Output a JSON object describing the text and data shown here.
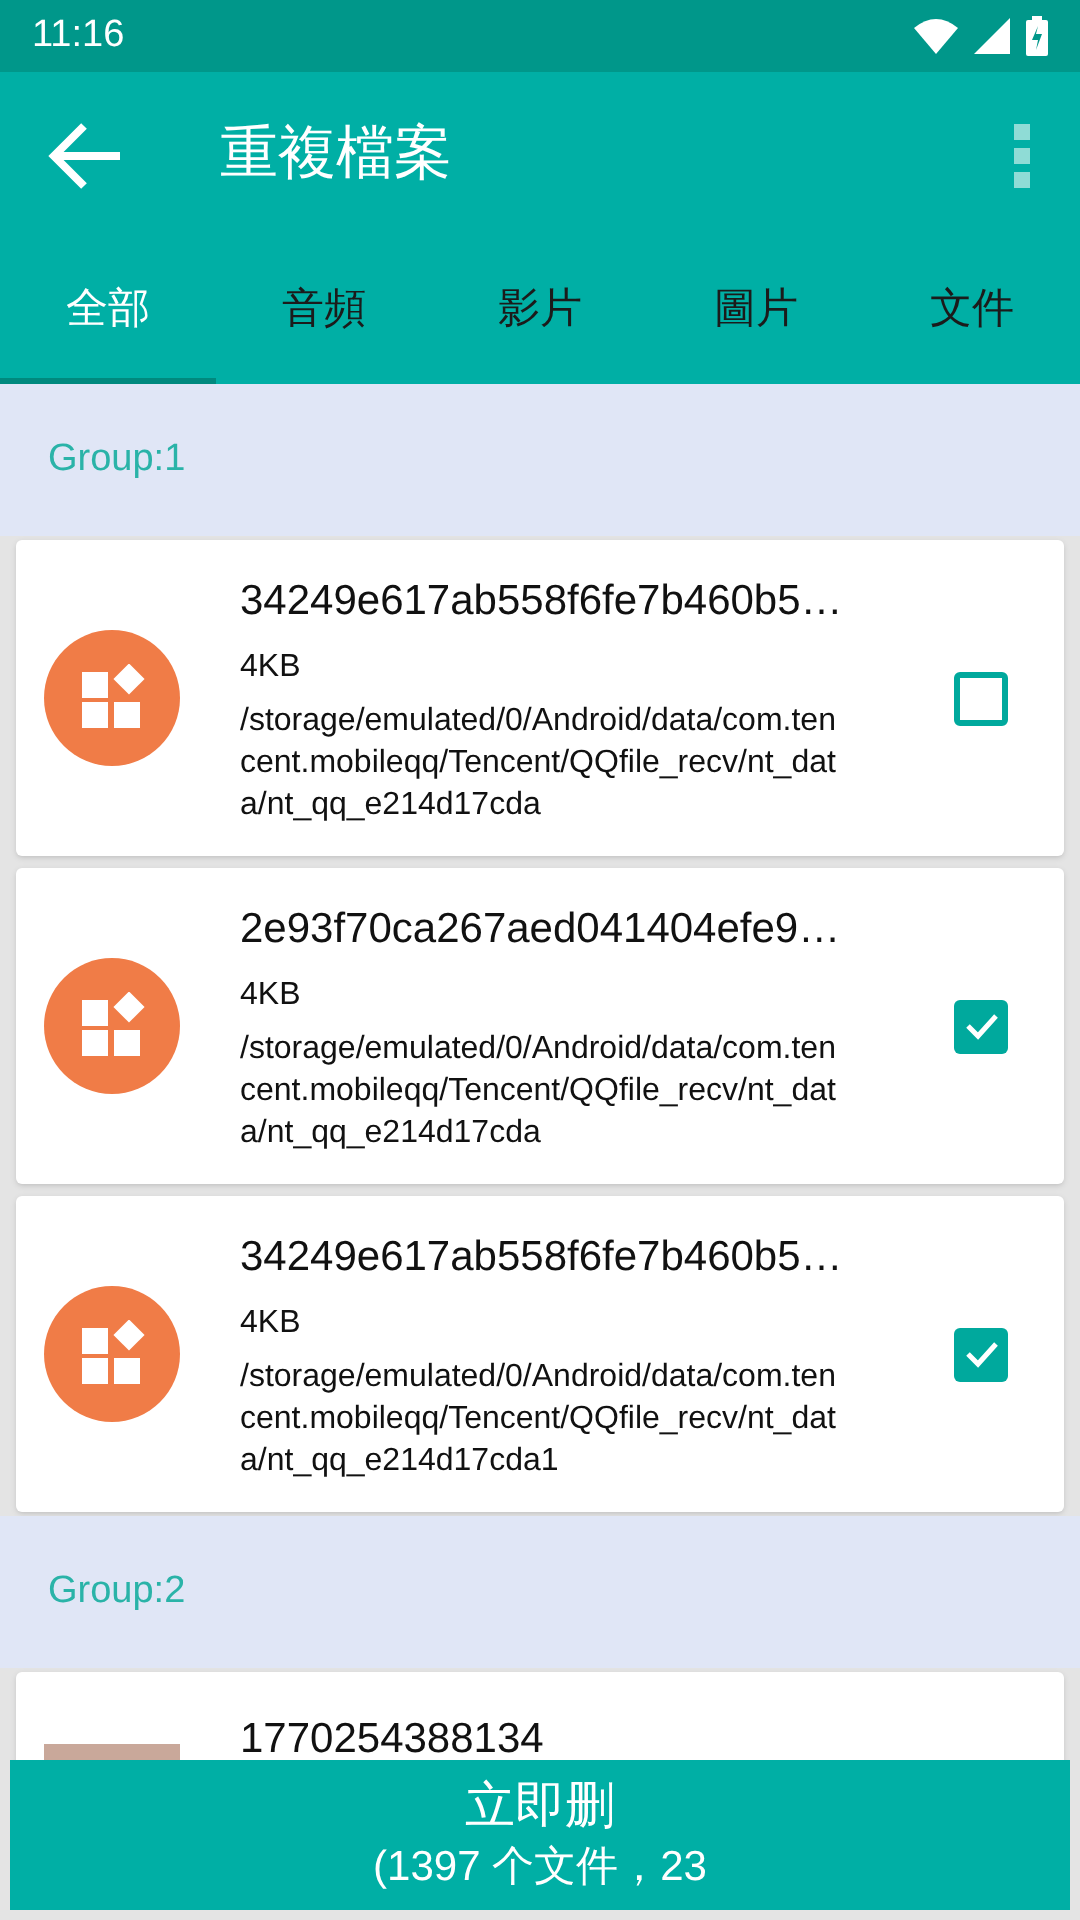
{
  "status_bar": {
    "time": "11:16"
  },
  "app_bar": {
    "title": "重複檔案"
  },
  "tabs": [
    {
      "label": "全部",
      "selected": true
    },
    {
      "label": "音頻",
      "selected": false
    },
    {
      "label": "影片",
      "selected": false
    },
    {
      "label": "圖片",
      "selected": false
    },
    {
      "label": "文件",
      "selected": false
    }
  ],
  "groups": [
    {
      "title": "Group:1",
      "files": [
        {
          "kind": "app",
          "name": "34249e617ab558f6fe7b460b5…",
          "size": "4KB",
          "path": "/storage/emulated/0/Android/data/com.tencent.mobileqq/Tencent/QQfile_recv/nt_data/nt_qq_e214d17cda",
          "checked": false
        },
        {
          "kind": "app",
          "name": "2e93f70ca267aed041404efe9…",
          "size": "4KB",
          "path": "/storage/emulated/0/Android/data/com.tencent.mobileqq/Tencent/QQfile_recv/nt_data/nt_qq_e214d17cda",
          "checked": true
        },
        {
          "kind": "app",
          "name": "34249e617ab558f6fe7b460b5…",
          "size": "4KB",
          "path": "/storage/emulated/0/Android/data/com.tencent.mobileqq/Tencent/QQfile_recv/nt_data/nt_qq_e214d17cda1",
          "checked": true
        }
      ]
    },
    {
      "title": "Group:2",
      "files": [
        {
          "kind": "photo",
          "name": "1770254388134"
        }
      ]
    }
  ],
  "delete_button": {
    "label": "立即删",
    "summary": "(1397 个文件，23"
  }
}
